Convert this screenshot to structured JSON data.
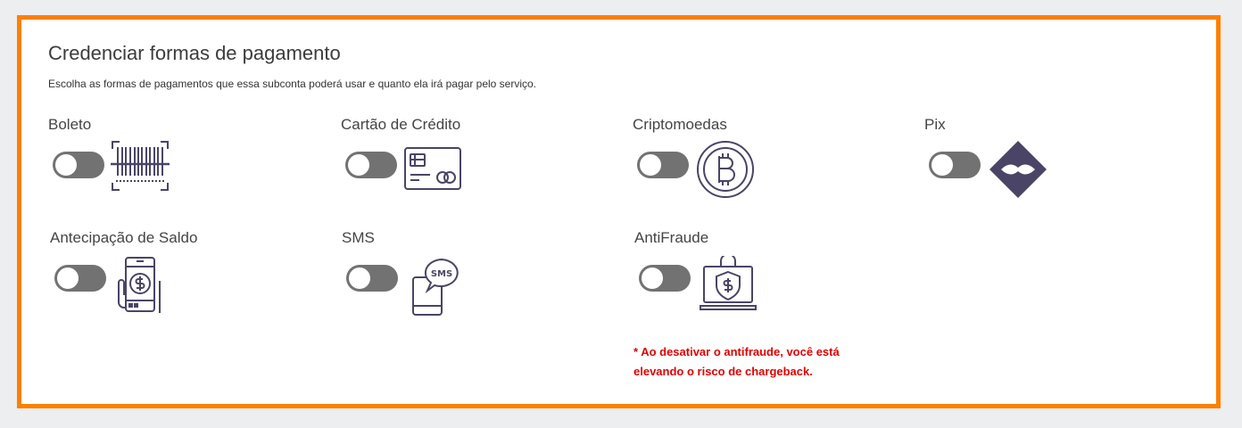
{
  "header": {
    "title": "Credenciar formas de pagamento",
    "subtitle": "Escolha as formas de pagamentos que essa subconta poderá usar e quanto ela irá pagar pelo serviço."
  },
  "methods": [
    {
      "label": "Boleto",
      "enabled": false,
      "icon": "barcode-icon"
    },
    {
      "label": "Cartão de Crédito",
      "enabled": false,
      "icon": "credit-card-icon"
    },
    {
      "label": "Criptomoedas",
      "enabled": false,
      "icon": "bitcoin-icon"
    },
    {
      "label": "Pix",
      "enabled": false,
      "icon": "pix-icon"
    },
    {
      "label": "Antecipação de Saldo",
      "enabled": false,
      "icon": "mobile-money-icon"
    },
    {
      "label": "SMS",
      "enabled": false,
      "icon": "sms-icon"
    },
    {
      "label": "AntiFraude",
      "enabled": false,
      "icon": "laptop-shield-lock-icon"
    }
  ],
  "warning": {
    "line1": "* Ao desativar o antifraude, você está",
    "line2": "elevando o risco de chargeback."
  },
  "colors": {
    "accent_border": "#ff7f00",
    "icon_color": "#4a4466",
    "toggle_off": "#727272",
    "warning_text": "#e00000"
  }
}
